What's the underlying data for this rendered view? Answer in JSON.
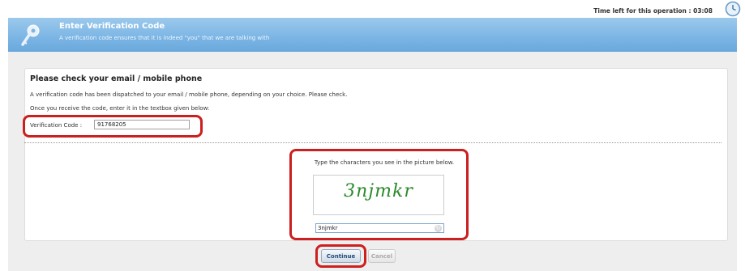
{
  "header": {
    "timer_label": "Time left for this operation : 03:08"
  },
  "banner": {
    "title": "Enter Verification Code",
    "subtitle": "A verification code ensures that it is indeed \"you\" that we are talking with"
  },
  "verification": {
    "heading": "Please check your email / mobile phone",
    "line1": "A verification code has been dispatched to your email / mobile phone, depending on your choice. Please check.",
    "line2": "Once you receive the code, enter it in the textbox given below:",
    "field_label": "Verification Code :",
    "field_value": "91768205"
  },
  "captcha": {
    "instruction": "Type the characters you see in the picture below.",
    "image_text": "3njmkr",
    "input_value": "3njmkr"
  },
  "buttons": {
    "continue_label": "Continue",
    "cancel_label": "Cancel"
  },
  "colors": {
    "banner": "#7db6e5",
    "highlight": "#cc1f1f",
    "captcha_text": "#2a8a2a"
  },
  "icons": [
    "clock-icon",
    "key-icon",
    "refresh-icon"
  ]
}
